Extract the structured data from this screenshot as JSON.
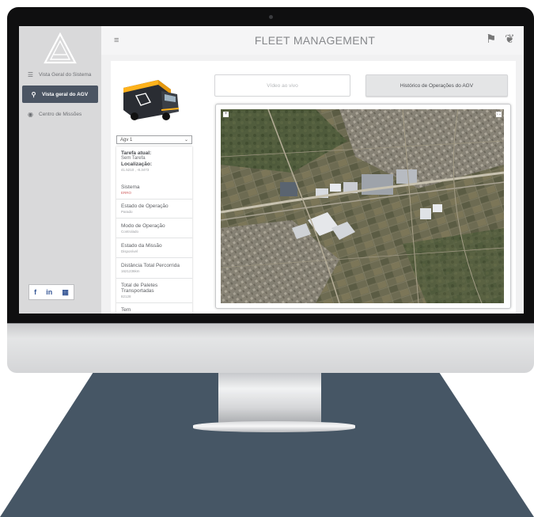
{
  "app": {
    "title": "FLEET MANAGEMENT"
  },
  "sidebar": {
    "items": [
      {
        "label": "Vista Geral do Sistema",
        "icon": "list-icon"
      },
      {
        "label": "Vista geral do AGV",
        "icon": "search-icon",
        "active": true
      },
      {
        "label": "Centro de Missões",
        "icon": "target-icon"
      }
    ],
    "social": [
      "f",
      "in",
      "▦"
    ]
  },
  "header": {
    "menu_icon": "hamburger-icon",
    "icons": [
      "flag-icon",
      "leaf-icon"
    ]
  },
  "agv": {
    "selected": "Agv 1",
    "tarefa_label": "Tarefa atual:",
    "tarefa_value": "Sem Tarefa",
    "localizacao_label": "Localização:",
    "localizacao_value": "41.5210 , -8.3473",
    "sistema_label": "Sistema",
    "sistema_value": "ERRO",
    "estado_operacao_label": "Estado de Operação",
    "estado_operacao_value": "Parado",
    "modo_operacao_label": "Modo de Operação",
    "modo_operacao_value": "Controlado",
    "estado_missao_label": "Estado da Missão",
    "estado_missao_value": "Disponível",
    "distancia_label": "Distância Total Percorrida",
    "distancia_value": "1621236km",
    "paletes_label": "Total de Paletes Transportadas",
    "paletes_value": "82128",
    "extra_label": "Tem"
  },
  "buttons": {
    "live": "Vídeo ao vivo",
    "history": "Histórico de Operações do AGV"
  },
  "colors": {
    "sidebar_active": "#4b5563",
    "accent_red": "#d06060"
  }
}
